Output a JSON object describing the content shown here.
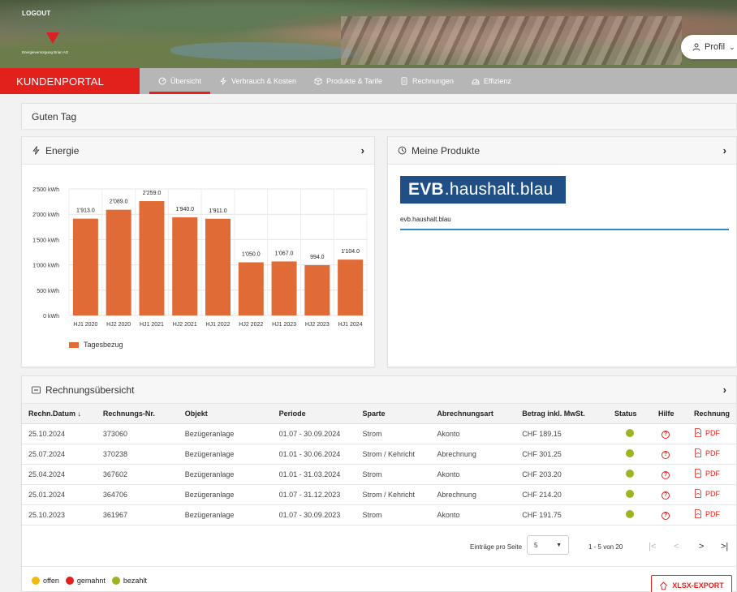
{
  "header": {
    "logout_label": "LOGOUT",
    "logo_text": "Energieversorgung Brian AG",
    "profile_label": "Profil"
  },
  "nav": {
    "brand": "KUNDENPORTAL",
    "items": [
      {
        "label": "Übersicht",
        "icon": "dashboard-icon",
        "active": true
      },
      {
        "label": "Verbrauch & Kosten",
        "icon": "bolt-icon"
      },
      {
        "label": "Produkte & Tarife",
        "icon": "box-icon"
      },
      {
        "label": "Rechnungen",
        "icon": "document-icon"
      },
      {
        "label": "Effizienz",
        "icon": "efficiency-icon"
      }
    ]
  },
  "greeting": "Guten Tag",
  "energy": {
    "title": "Energie",
    "legend": "Tagesbezug"
  },
  "chart_data": {
    "type": "bar",
    "categories": [
      "HJ1 2020",
      "HJ2 2020",
      "HJ1 2021",
      "HJ2 2021",
      "HJ1 2022",
      "HJ2 2022",
      "HJ1 2023",
      "HJ2 2023",
      "HJ1 2024"
    ],
    "series": [
      {
        "name": "Tagesbezug",
        "values": [
          1913.0,
          2089.0,
          2259.0,
          1940.0,
          1911.0,
          1050.0,
          1067.0,
          994.0,
          1104.0
        ],
        "color": "#e06b36"
      }
    ],
    "value_labels": [
      "1'913.0",
      "2'089.0",
      "2'259.0",
      "1'940.0",
      "1'911.0",
      "1'050.0",
      "1'067.0",
      "994.0",
      "1'104.0"
    ],
    "ylim": [
      0,
      2500
    ],
    "yticks": [
      0,
      500,
      1000,
      1500,
      2000,
      2500
    ],
    "ytick_labels": [
      "0 kWh",
      "500 kWh",
      "1'000 kWh",
      "1'500 kWh",
      "2'000 kWh",
      "2'500 kWh"
    ],
    "grid": true,
    "legend_position": "bottom-left"
  },
  "products": {
    "title": "Meine Produkte",
    "logo_prefix": "EVB",
    "logo_suffix": ".haushalt.blau",
    "product_name": "evb.haushalt.blau"
  },
  "invoices": {
    "title": "Rechnungsübersicht",
    "columns": [
      "Rechn.Datum ↓",
      "Rechnungs-Nr.",
      "Objekt",
      "Periode",
      "Sparte",
      "Abrechnungsart",
      "Betrag inkl. MwSt.",
      "Status",
      "Hilfe",
      "Rechnung"
    ],
    "rows": [
      {
        "date": "25.10.2024",
        "nr": "373060",
        "object": "Bezügeranlage",
        "period": "01.07 - 30.09.2024",
        "sparte": "Strom",
        "type": "Akonto",
        "amount": "CHF 189.15",
        "status": "bezahlt",
        "pdf": "PDF"
      },
      {
        "date": "25.07.2024",
        "nr": "370238",
        "object": "Bezügeranlage",
        "period": "01.01 - 30.06.2024",
        "sparte": "Strom / Kehricht",
        "type": "Abrechnung",
        "amount": "CHF 301.25",
        "status": "bezahlt",
        "pdf": "PDF"
      },
      {
        "date": "25.04.2024",
        "nr": "367602",
        "object": "Bezügeranlage",
        "period": "01.01 - 31.03.2024",
        "sparte": "Strom",
        "type": "Akonto",
        "amount": "CHF 203.20",
        "status": "bezahlt",
        "pdf": "PDF"
      },
      {
        "date": "25.01.2024",
        "nr": "364706",
        "object": "Bezügeranlage",
        "period": "01.07 - 31.12.2023",
        "sparte": "Strom / Kehricht",
        "type": "Abrechnung",
        "amount": "CHF 214.20",
        "status": "bezahlt",
        "pdf": "PDF"
      },
      {
        "date": "25.10.2023",
        "nr": "361967",
        "object": "Bezügeranlage",
        "period": "01.07 - 30.09.2023",
        "sparte": "Strom",
        "type": "Akonto",
        "amount": "CHF 191.75",
        "status": "bezahlt",
        "pdf": "PDF"
      }
    ],
    "pager": {
      "label": "Einträge pro Seite",
      "per_page": "5",
      "range": "1 - 5 von 20",
      "first": "|<",
      "prev": "<",
      "next": ">",
      "last": ">|"
    },
    "status_legend": [
      {
        "label": "offen",
        "color": "#f2b90f"
      },
      {
        "label": "gemahnt",
        "color": "#e3211c"
      },
      {
        "label": "bezahlt",
        "color": "#9cb420"
      }
    ],
    "export_label": "XLSX-EXPORT"
  },
  "colors": {
    "accent": "#e3211c",
    "bar": "#e06b36",
    "paid": "#9cb420",
    "product_blue": "#1f4f86"
  }
}
